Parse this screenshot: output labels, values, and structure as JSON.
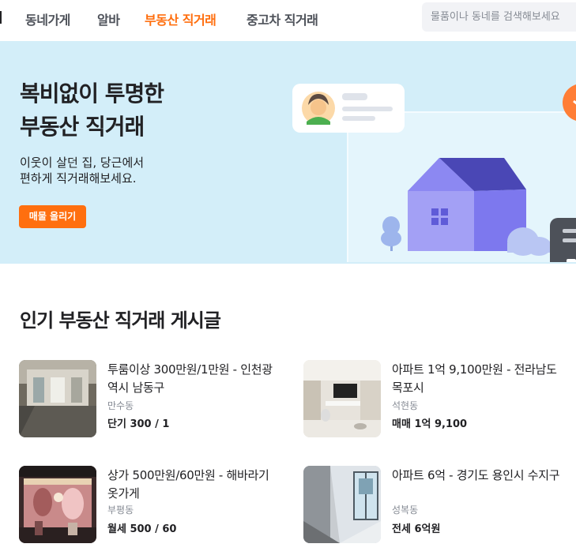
{
  "nav": {
    "items": [
      {
        "label": "동네가게"
      },
      {
        "label": "알바"
      },
      {
        "label": "부동산 직거래"
      },
      {
        "label": "중고차 직거래"
      }
    ],
    "search_placeholder": "물품이나 동네를 검색해보세요"
  },
  "hero": {
    "title_line1": "복비없이 투명한",
    "title_line2": "부동산 직거래",
    "desc_line1": "이웃이 살던 집, 당근에서",
    "desc_line2": "편하게 직거래해보세요.",
    "cta_label": "매물 올리기"
  },
  "section": {
    "title": "인기 부동산 직거래 게시글"
  },
  "listings": [
    {
      "title": "투룸이상 300만원/1만원 - 인천광역시 남동구",
      "region": "만수동",
      "price": "단기 300 / 1",
      "photo": "empty-room-photo"
    },
    {
      "title": "아파트 1억 9,100만원 - 전라남도 목포시",
      "region": "석현동",
      "price": "매매 1억 9,100",
      "photo": "living-room-photo"
    },
    {
      "title": "상가 500만원/60만원 - 해바라기 옷가게",
      "region": "부평동",
      "price": "월세 500 / 60",
      "photo": "clothing-store-photo"
    },
    {
      "title": "아파트 6억 - 경기도 용인시 수지구",
      "region": "성복동",
      "price": "전세 6억원",
      "photo": "balcony-photo"
    }
  ],
  "colors": {
    "brand": "#ff6f0f",
    "hero_bg": "#d3eef9",
    "muted_text": "#868b94"
  }
}
